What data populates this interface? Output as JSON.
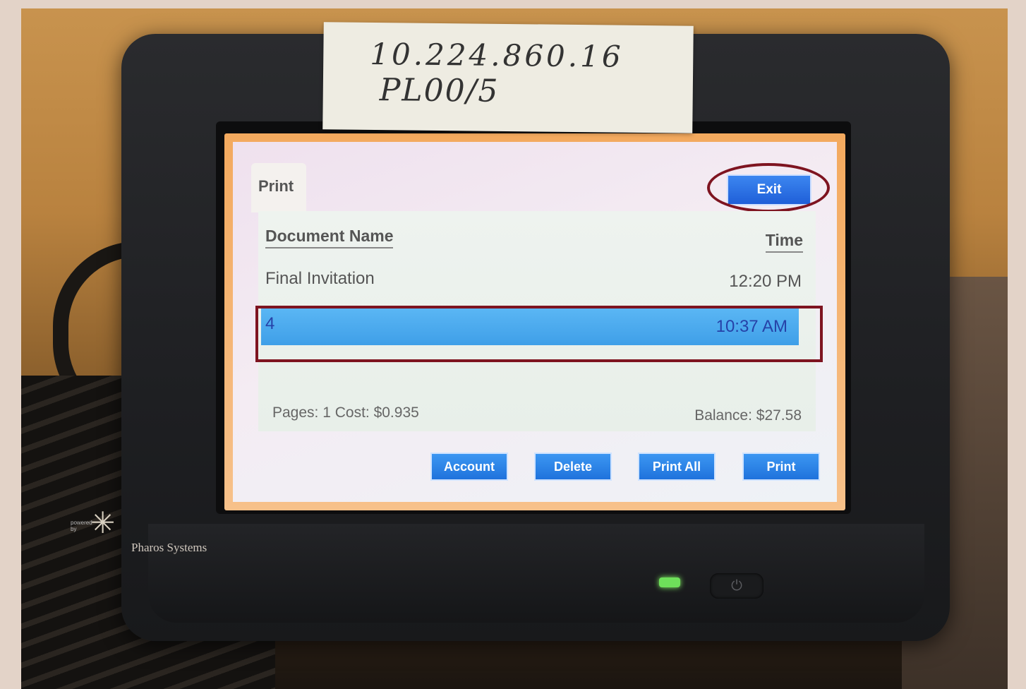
{
  "note": {
    "line1": "10.224.860.16",
    "line2": "PL00/5"
  },
  "tab": {
    "label": "Print"
  },
  "exit": {
    "label": "Exit"
  },
  "columns": {
    "document": "Document Name",
    "time": "Time"
  },
  "jobs": [
    {
      "name": "Final Invitation",
      "time": "12:20 PM",
      "selected": false
    },
    {
      "name": "4",
      "time": "10:37 AM",
      "selected": true
    }
  ],
  "summary": {
    "pages_cost": "Pages: 1 Cost: $0.935",
    "balance": "Balance:  $27.58"
  },
  "buttons": {
    "account": "Account",
    "delete": "Delete",
    "print_all": "Print All",
    "print": "Print"
  },
  "brand": {
    "powered": "powered by",
    "name": "Pharos Systems"
  },
  "colors": {
    "selected_row": "#4aaaf0",
    "button": "#2b82e6",
    "highlight_outline": "#7e1420"
  },
  "icons": {
    "power": "power-icon",
    "status_led": "led-indicator"
  }
}
